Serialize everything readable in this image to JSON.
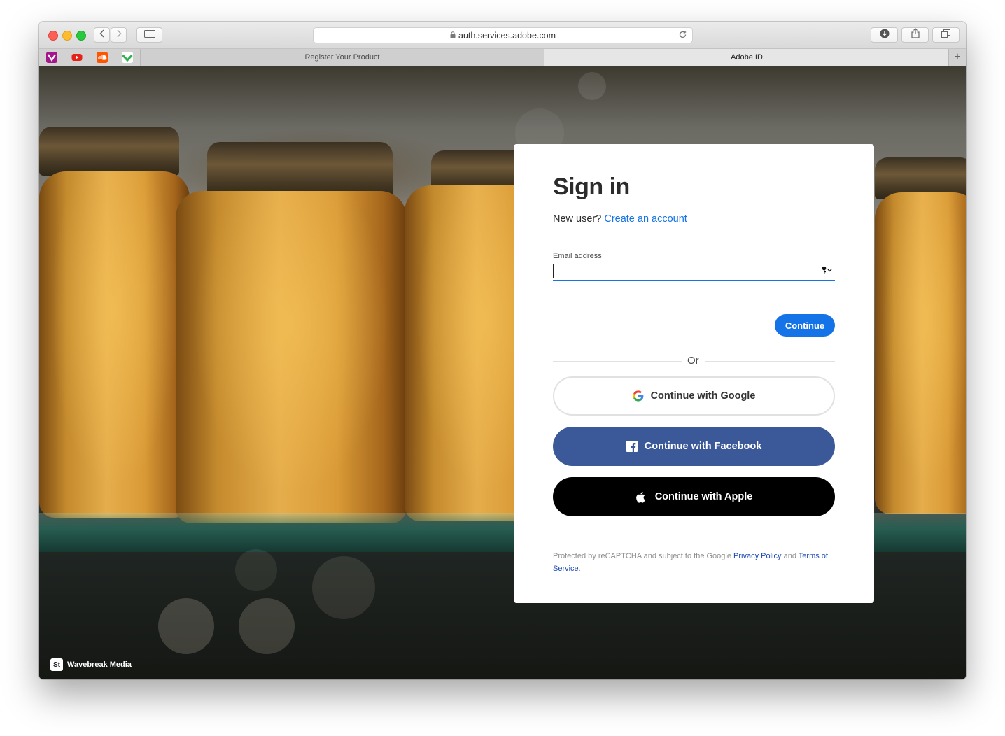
{
  "browser": {
    "url": "auth.services.adobe.com",
    "tabs": [
      {
        "label": "Register Your Product",
        "active": false
      },
      {
        "label": "Adobe ID",
        "active": true
      }
    ],
    "favorites": [
      "vivaldi-favicon",
      "youtube-favicon",
      "soundcloud-favicon",
      "feedly-favicon"
    ]
  },
  "signin": {
    "title": "Sign in",
    "new_user_text": "New user?",
    "create_account_link": "Create an account",
    "email_label": "Email address",
    "email_value": "",
    "continue_button": "Continue",
    "or_text": "Or",
    "google_button": "Continue with Google",
    "facebook_button": "Continue with Facebook",
    "apple_button": "Continue with Apple",
    "legal": {
      "prefix": "Protected by reCAPTCHA and subject to the Google",
      "privacy_link": "Privacy Policy",
      "and": "and",
      "terms_link": "Terms of Service",
      "suffix": "."
    }
  },
  "background": {
    "credit_badge": "St",
    "credit_text": "Wavebreak Media"
  },
  "colors": {
    "accent": "#1473e6",
    "facebook": "#3b5998",
    "apple": "#000000"
  }
}
